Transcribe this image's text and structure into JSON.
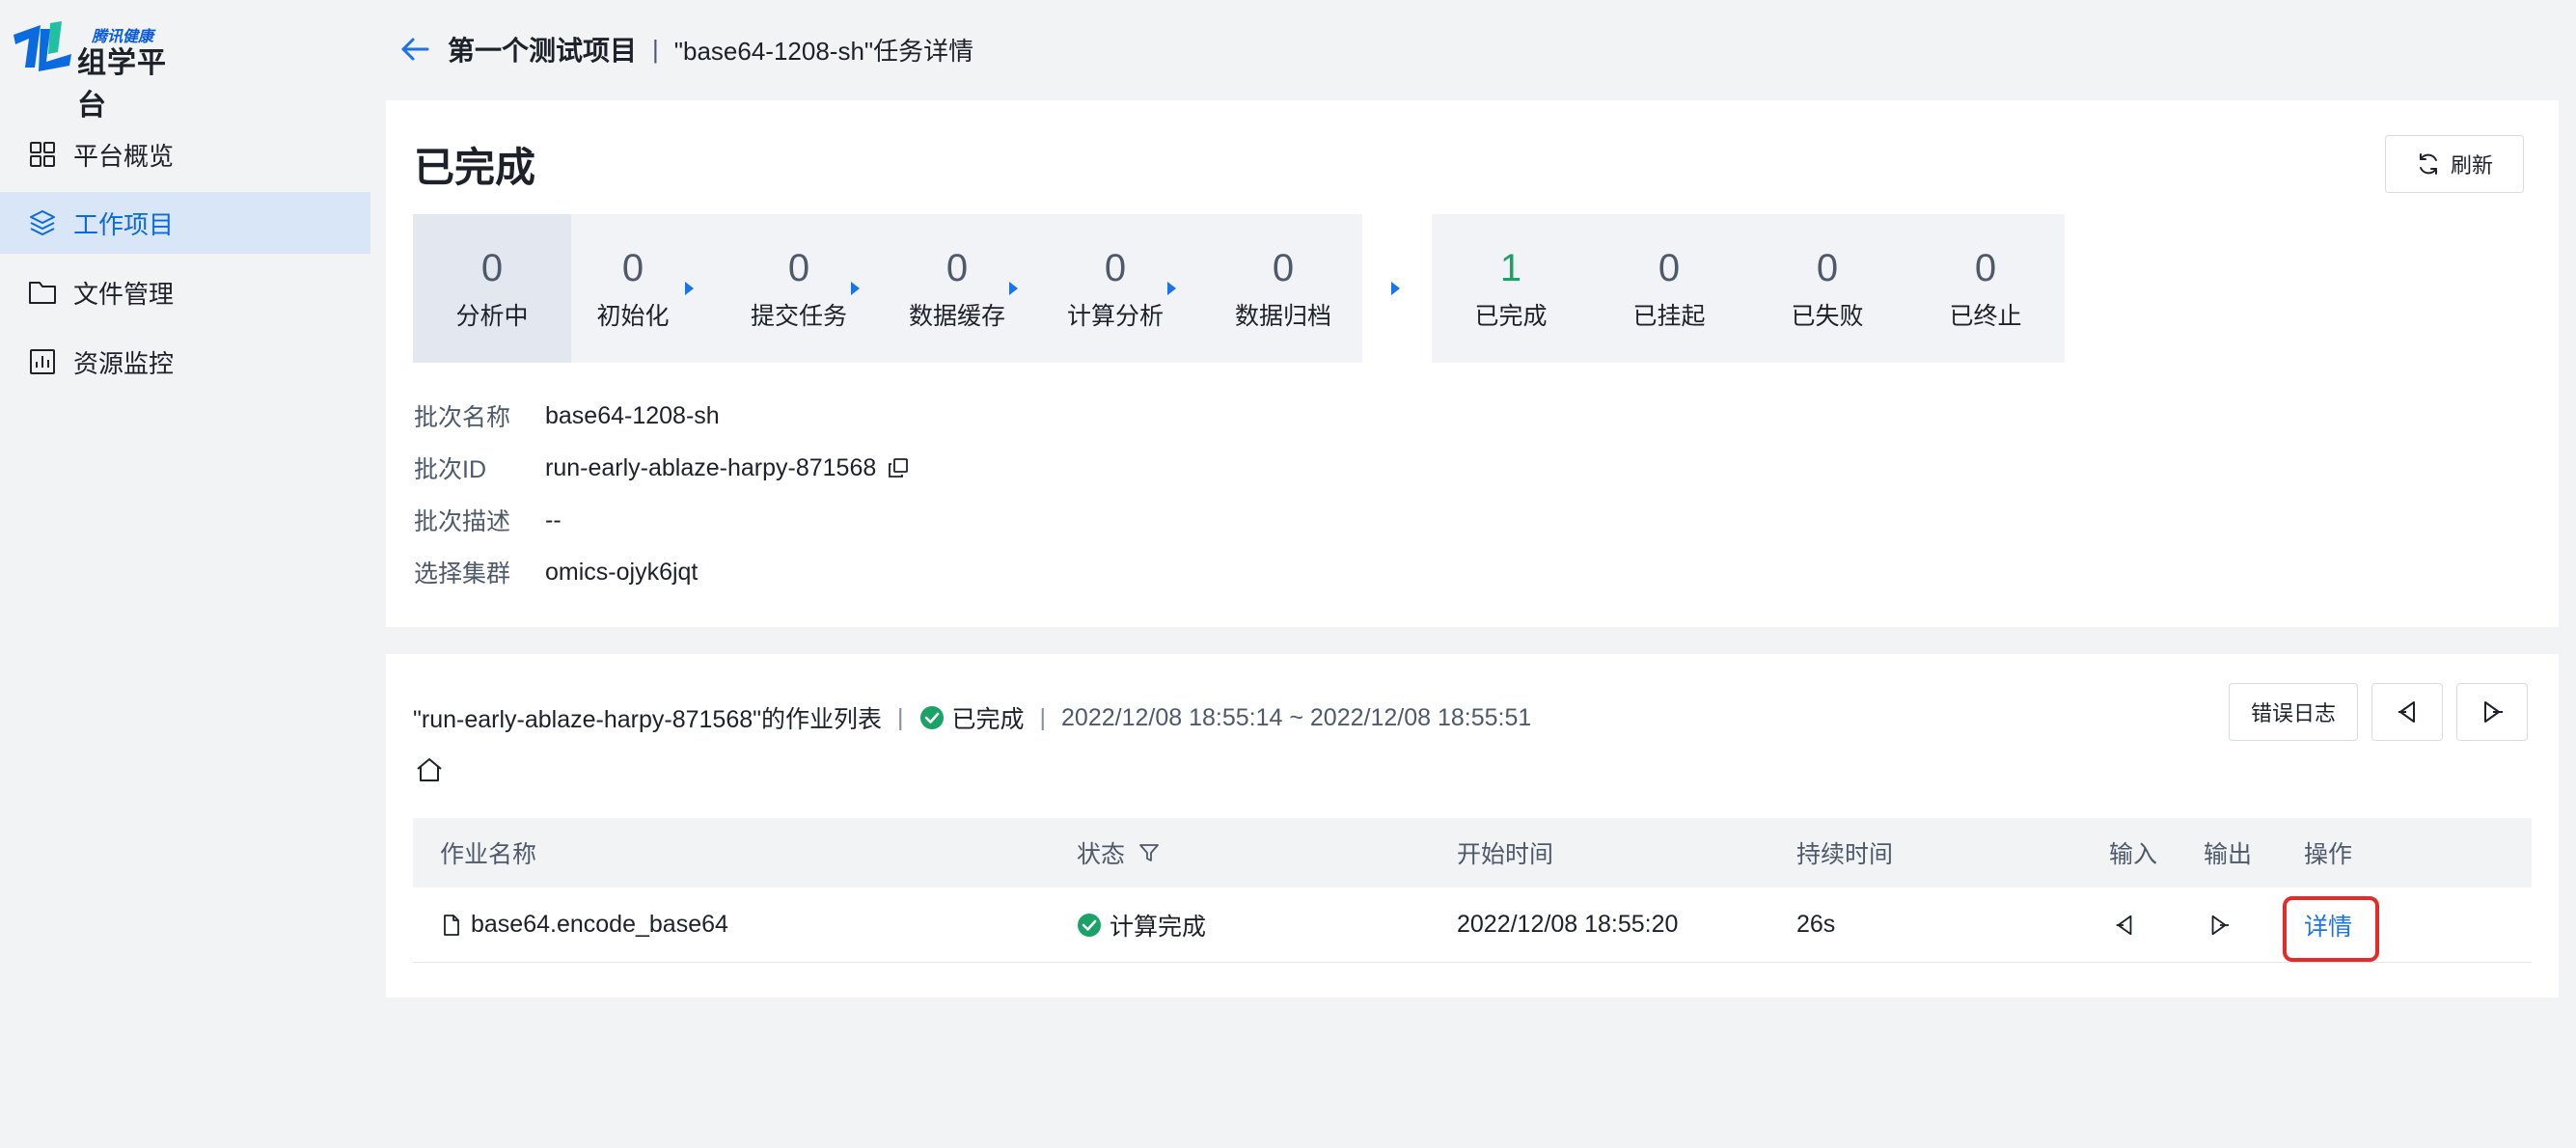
{
  "logo": {
    "sub": "腾讯健康",
    "main": "组学平台"
  },
  "sidebar": {
    "items": [
      {
        "label": "平台概览",
        "icon": "grid-icon",
        "active": false
      },
      {
        "label": "工作项目",
        "icon": "layers-icon",
        "active": true
      },
      {
        "label": "文件管理",
        "icon": "folder-icon",
        "active": false
      },
      {
        "label": "资源监控",
        "icon": "bar-chart-icon",
        "active": false
      }
    ]
  },
  "header": {
    "project": "第一个测试项目",
    "separator": "|",
    "task": "\"base64-1208-sh\"任务详情"
  },
  "status": {
    "title": "已完成",
    "refresh_label": "刷新"
  },
  "pipeline": {
    "stages": [
      {
        "count": "0",
        "label": "分析中"
      },
      {
        "count": "0",
        "label": "初始化"
      },
      {
        "count": "0",
        "label": "提交任务"
      },
      {
        "count": "0",
        "label": "数据缓存"
      },
      {
        "count": "0",
        "label": "计算分析"
      },
      {
        "count": "0",
        "label": "数据归档"
      },
      {
        "count": "1",
        "label": "已完成"
      },
      {
        "count": "0",
        "label": "已挂起"
      },
      {
        "count": "0",
        "label": "已失败"
      },
      {
        "count": "0",
        "label": "已终止"
      }
    ],
    "accent": "#1a73e8",
    "success_color": "#1aa267"
  },
  "info": {
    "batch_name_label": "批次名称",
    "batch_name": "base64-1208-sh",
    "batch_id_label": "批次ID",
    "batch_id": "run-early-ablaze-harpy-871568",
    "batch_desc_label": "批次描述",
    "batch_desc": "--",
    "cluster_label": "选择集群",
    "cluster": "omics-ojyk6jqt"
  },
  "joblist": {
    "title": "\"run-early-ablaze-harpy-871568\"的作业列表",
    "status": "已完成",
    "time_range": "2022/12/08 18:55:14 ~ 2022/12/08 18:55:51",
    "error_log_label": "错误日志",
    "columns": [
      "作业名称",
      "状态",
      "开始时间",
      "持续时间",
      "输入",
      "输出",
      "操作"
    ],
    "rows": [
      {
        "name": "base64.encode_base64",
        "status": "计算完成",
        "start_time": "2022/12/08 18:55:20",
        "duration": "26s",
        "action": "详情"
      }
    ]
  }
}
